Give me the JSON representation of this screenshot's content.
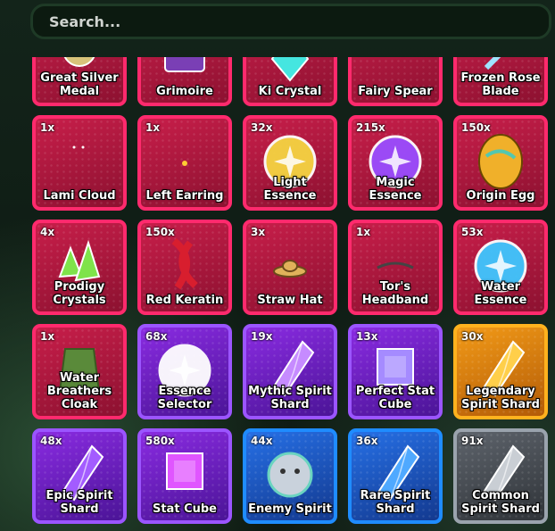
{
  "search": {
    "placeholder": "Search..."
  },
  "items": [
    {
      "count": "",
      "name": "Great Silver Medal",
      "rarity": "red",
      "icon": "medal-icon",
      "color": "#d8c37a"
    },
    {
      "count": "",
      "name": "Grimoire",
      "rarity": "red",
      "icon": "book-icon",
      "color": "#7a3fb5"
    },
    {
      "count": "",
      "name": "Ki Crystal",
      "rarity": "red",
      "icon": "crystal-icon",
      "color": "#45e6e0"
    },
    {
      "count": "",
      "name": "Fairy Spear",
      "rarity": "red",
      "icon": "spear-icon",
      "color": "#c9b34a"
    },
    {
      "count": "",
      "name": "Frozen Rose Blade",
      "rarity": "red",
      "icon": "blade-icon",
      "color": "#9fe3ff"
    },
    {
      "count": "1x",
      "name": "Lami Cloud",
      "rarity": "red",
      "icon": "cloud-icon",
      "color": "#ffffff"
    },
    {
      "count": "1x",
      "name": "Left Earring",
      "rarity": "red",
      "icon": "earring-icon",
      "color": "#ffcc33"
    },
    {
      "count": "32x",
      "name": "Light Essence",
      "rarity": "red",
      "icon": "orb-icon",
      "color": "#f5d442"
    },
    {
      "count": "215x",
      "name": "Magic Essence",
      "rarity": "red",
      "icon": "orb-icon",
      "color": "#9a4dff"
    },
    {
      "count": "150x",
      "name": "Origin Egg",
      "rarity": "red",
      "icon": "egg-icon",
      "color": "#f0b02a"
    },
    {
      "count": "4x",
      "name": "Prodigy Crystals",
      "rarity": "red",
      "icon": "crystal-cluster-icon",
      "color": "#7fe34a"
    },
    {
      "count": "150x",
      "name": "Red Keratin",
      "rarity": "red",
      "icon": "keratin-icon",
      "color": "#d81e2e"
    },
    {
      "count": "3x",
      "name": "Straw Hat",
      "rarity": "red",
      "icon": "hat-icon",
      "color": "#e0b15a"
    },
    {
      "count": "1x",
      "name": "Tor's Headband",
      "rarity": "red",
      "icon": "headband-icon",
      "color": "#444444"
    },
    {
      "count": "53x",
      "name": "Water Essence",
      "rarity": "red",
      "icon": "orb-icon",
      "color": "#3fc6ff"
    },
    {
      "count": "1x",
      "name": "Water Breathers Cloak",
      "rarity": "red",
      "icon": "cloak-icon",
      "color": "#5a8a3a"
    },
    {
      "count": "68x",
      "name": "Essence Selector",
      "rarity": "purple",
      "icon": "selector-orb-icon",
      "color": "#ffffff"
    },
    {
      "count": "19x",
      "name": "Mythic Spirit Shard",
      "rarity": "purple",
      "icon": "shard-icon",
      "color": "#c68bff"
    },
    {
      "count": "13x",
      "name": "Perfect Stat Cube",
      "rarity": "purple",
      "icon": "cube-icon",
      "color": "#a58bff"
    },
    {
      "count": "30x",
      "name": "Legendary Spirit Shard",
      "rarity": "gold",
      "icon": "shard-icon",
      "color": "#ffcf4a"
    },
    {
      "count": "48x",
      "name": "Epic Spirit Shard",
      "rarity": "purple",
      "icon": "shard-icon",
      "color": "#a35cff"
    },
    {
      "count": "580x",
      "name": "Stat Cube",
      "rarity": "purple",
      "icon": "cube-icon",
      "color": "#e055ff"
    },
    {
      "count": "44x",
      "name": "Enemy Spirit",
      "rarity": "blue",
      "icon": "spirit-icon",
      "color": "#c9d2dc"
    },
    {
      "count": "36x",
      "name": "Rare Spirit Shard",
      "rarity": "blue",
      "icon": "shard-icon",
      "color": "#4fa9ff"
    },
    {
      "count": "91x",
      "name": "Common Spirit Shard",
      "rarity": "gray",
      "icon": "shard-icon",
      "color": "#c9ced4"
    }
  ]
}
